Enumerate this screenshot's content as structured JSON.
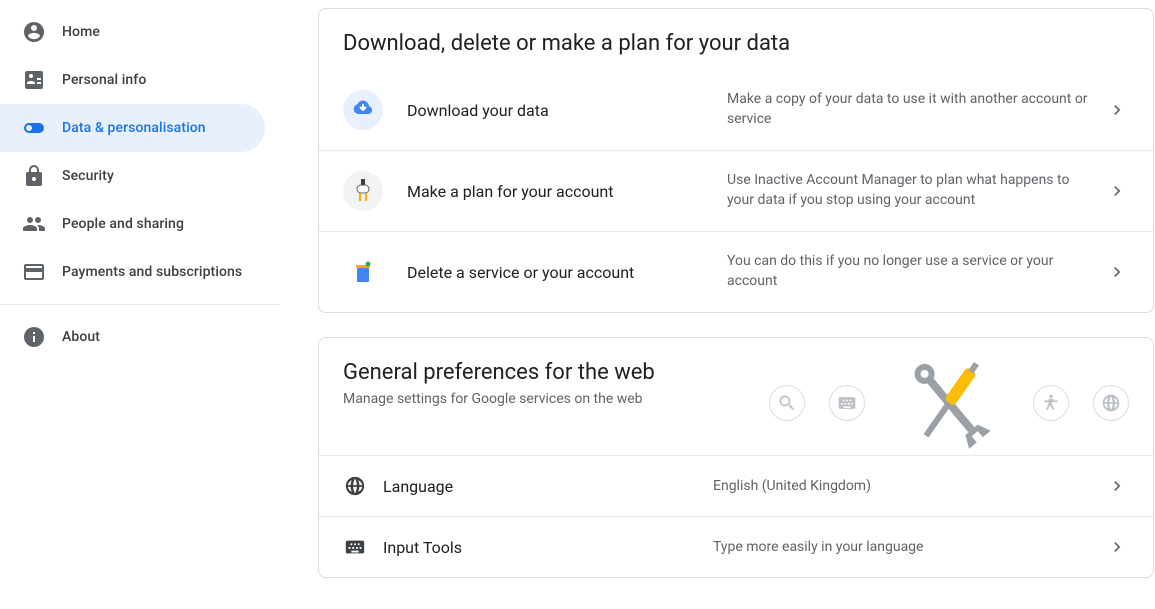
{
  "sidebar": {
    "items": [
      {
        "label": "Home"
      },
      {
        "label": "Personal info"
      },
      {
        "label": "Data & personalisation"
      },
      {
        "label": "Security"
      },
      {
        "label": "People and sharing"
      },
      {
        "label": "Payments and subscriptions"
      },
      {
        "label": "About"
      }
    ]
  },
  "cards": {
    "data_plan": {
      "title": "Download, delete or make a plan for your data",
      "rows": [
        {
          "title": "Download your data",
          "desc": "Make a copy of your data to use it with another account or service"
        },
        {
          "title": "Make a plan for your account",
          "desc": "Use Inactive Account Manager to plan what happens to your data if you stop using your account"
        },
        {
          "title": "Delete a service or your account",
          "desc": "You can do this if you no longer use a service or your account"
        }
      ]
    },
    "prefs": {
      "title": "General preferences for the web",
      "sub": "Manage settings for Google services on the web",
      "rows": [
        {
          "title": "Language",
          "desc": "English (United Kingdom)"
        },
        {
          "title": "Input Tools",
          "desc": "Type more easily in your language"
        }
      ]
    }
  }
}
